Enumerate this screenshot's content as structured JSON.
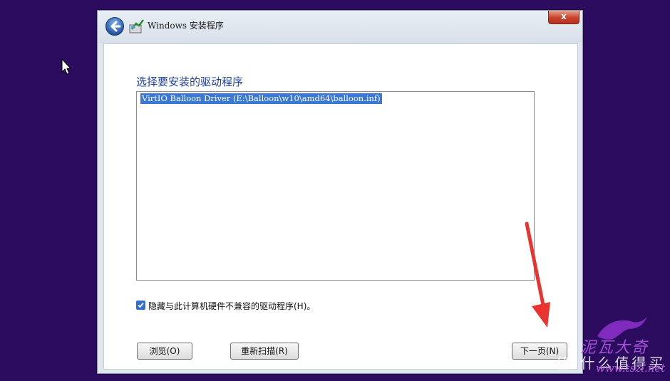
{
  "window": {
    "title": "Windows 安装程序",
    "close_label": "x"
  },
  "page": {
    "heading": "选择要安装的驱动程序"
  },
  "driver_list": {
    "items": [
      {
        "label": "VirtIO Balloon Driver (E:\\Balloon\\w10\\amd64\\balloon.inf)",
        "selected": true
      }
    ]
  },
  "options": {
    "hide_incompatible_label": "隐藏与此计算机硬件不兼容的驱动程序(H)。",
    "hide_incompatible_checked": true
  },
  "buttons": {
    "browse": "浏览(O)",
    "rescan": "重新扫描(R)",
    "next": "下一页(N)"
  },
  "watermark": {
    "line1": "泥瓦大奇",
    "line2": "值 什么值得买",
    "url": "www.tszi.net"
  },
  "colors": {
    "desktop": "#2b0c5f",
    "heading": "#1f3f9d",
    "selection": "#3a78d8",
    "annotation_arrow": "#e8332e"
  }
}
